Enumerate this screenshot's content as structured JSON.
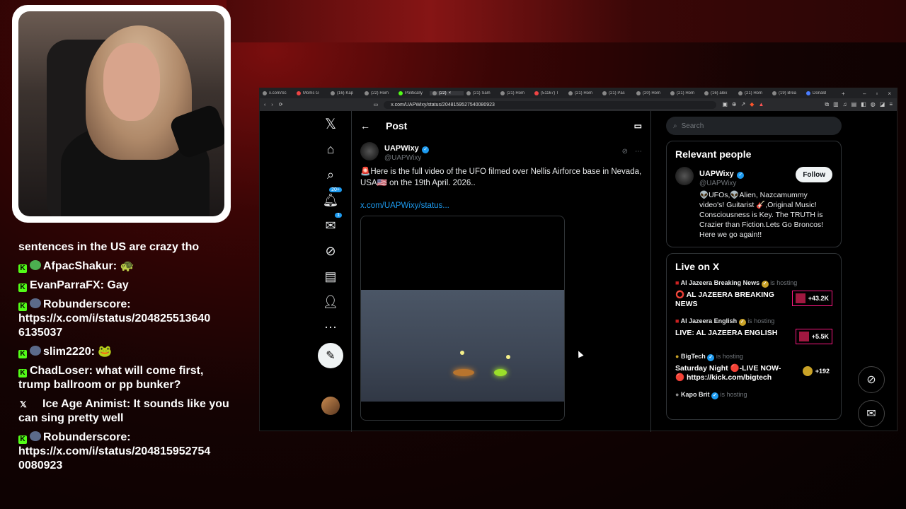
{
  "chat": [
    {
      "type": "plain",
      "text": "sentences in the US are crazy tho"
    },
    {
      "type": "kick",
      "emote": true,
      "user": "AfpacShakur:",
      "msg": "🐢"
    },
    {
      "type": "kick",
      "emote": false,
      "user": "EvanParraFX:",
      "msg": "Gay"
    },
    {
      "type": "kick",
      "emote": true,
      "user": "Robunderscore:",
      "msg": "https://x.com/i/status/204825513640 6135037"
    },
    {
      "type": "kick",
      "emote": true,
      "user": "slim2220:",
      "msg": "🐸"
    },
    {
      "type": "kick",
      "emote": false,
      "user": "ChadLoser:",
      "msg": "what will come first, trump ballroom or pp bunker?"
    },
    {
      "type": "x",
      "emote": false,
      "user": "Ice Age Animist:",
      "msg": "It sounds like you can sing pretty well"
    },
    {
      "type": "kick",
      "emote": true,
      "user": "Robunderscore:",
      "msg": "https://x.com/i/status/204815952754 0080923"
    }
  ],
  "browser": {
    "tabs": [
      "x.com/Sc",
      "Moms G",
      "(16) Kap",
      "(22) Hom",
      "Politically",
      "(22)",
      "(21) Sam",
      "(21) Hom",
      "(51167) T",
      "(21) Hom",
      "(21) Pas",
      "(20) Hom",
      "(21) Hom",
      "(16) alex",
      "(21) Hom",
      "(19) Brea",
      "Donald"
    ],
    "active_tab": 5,
    "url": "x.com/UAPWixy/status/2048159527540080923"
  },
  "nav": {
    "notifications_badge": "20+",
    "messages_badge": "1"
  },
  "post_header": {
    "title": "Post"
  },
  "tweet": {
    "name": "UAPWixy",
    "handle": "@UAPWixy",
    "text": "🚨Here is the full video of the UFO filmed over Nellis Airforce base in Nevada, USA🇺🇸 on the 19th April. 2026..",
    "link": "x.com/UAPWixy/status..."
  },
  "search": {
    "placeholder": "Search"
  },
  "relevant_people": {
    "title": "Relevant people",
    "name": "UAPWixy",
    "handle": "@UAPWixy",
    "follow_label": "Follow",
    "bio": "👽UFOs,👽Alien, Nazcamummy video's! Guitarist 🎸,Original Music! Consciousness is Key. The TRUTH is Crazier than Fiction.Lets Go Broncos! Here we go again!!"
  },
  "live": {
    "title": "Live on X",
    "hosting_label": "is hosting",
    "items": [
      {
        "host": "Al Jazeera Breaking News",
        "title": "⭕ AL JAZEERA BREAKING NEWS",
        "count": "+43.2K"
      },
      {
        "host": "Al Jazeera English",
        "title": "LIVE: AL JAZEERA ENGLISH",
        "count": "+5.5K"
      },
      {
        "host": "BigTech",
        "title": "Saturday Night 🔴-LIVE NOW- 🔴 https://kick.com/bigtech",
        "count": "+192"
      },
      {
        "host": "Kapo Brit",
        "title": "",
        "count": ""
      }
    ]
  },
  "colors": {
    "accent": "#1d9bf0",
    "kick_green": "#53fc18",
    "live_pink": "#f91880"
  }
}
